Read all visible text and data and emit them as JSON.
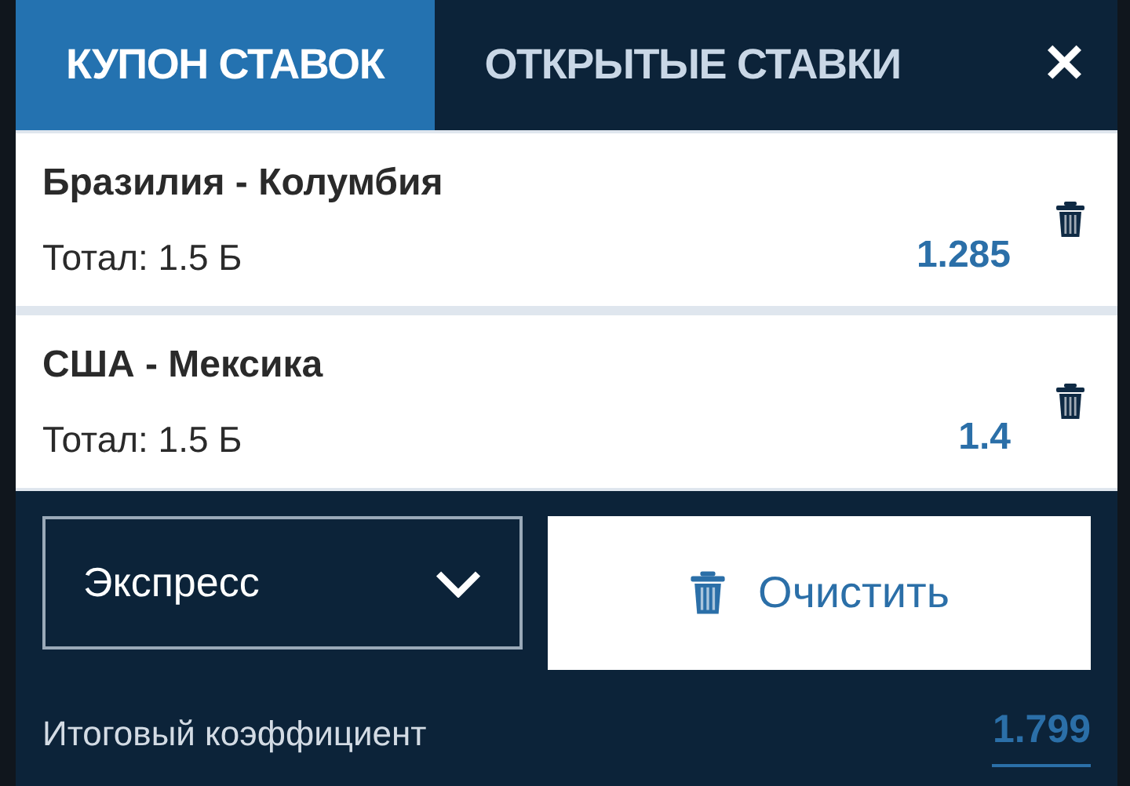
{
  "tabs": [
    {
      "label": "КУПОН СТАВОК",
      "selected": true
    },
    {
      "label": "ОТКРЫТЫЕ СТАВКИ",
      "selected": false
    }
  ],
  "close": {
    "label": "✕"
  },
  "bets": [
    {
      "match": "Бразилия - Колумбия",
      "market": "Тотал: 1.5 Б",
      "odds": "1.285"
    },
    {
      "match": "США - Мексика",
      "market": "Тотал: 1.5 Б",
      "odds": "1.4"
    }
  ],
  "bet_type": {
    "value": "Экспресс"
  },
  "clear_button": {
    "label": "Очистить"
  },
  "total": {
    "label": "Итоговый коэффициент",
    "value": "1.799"
  }
}
